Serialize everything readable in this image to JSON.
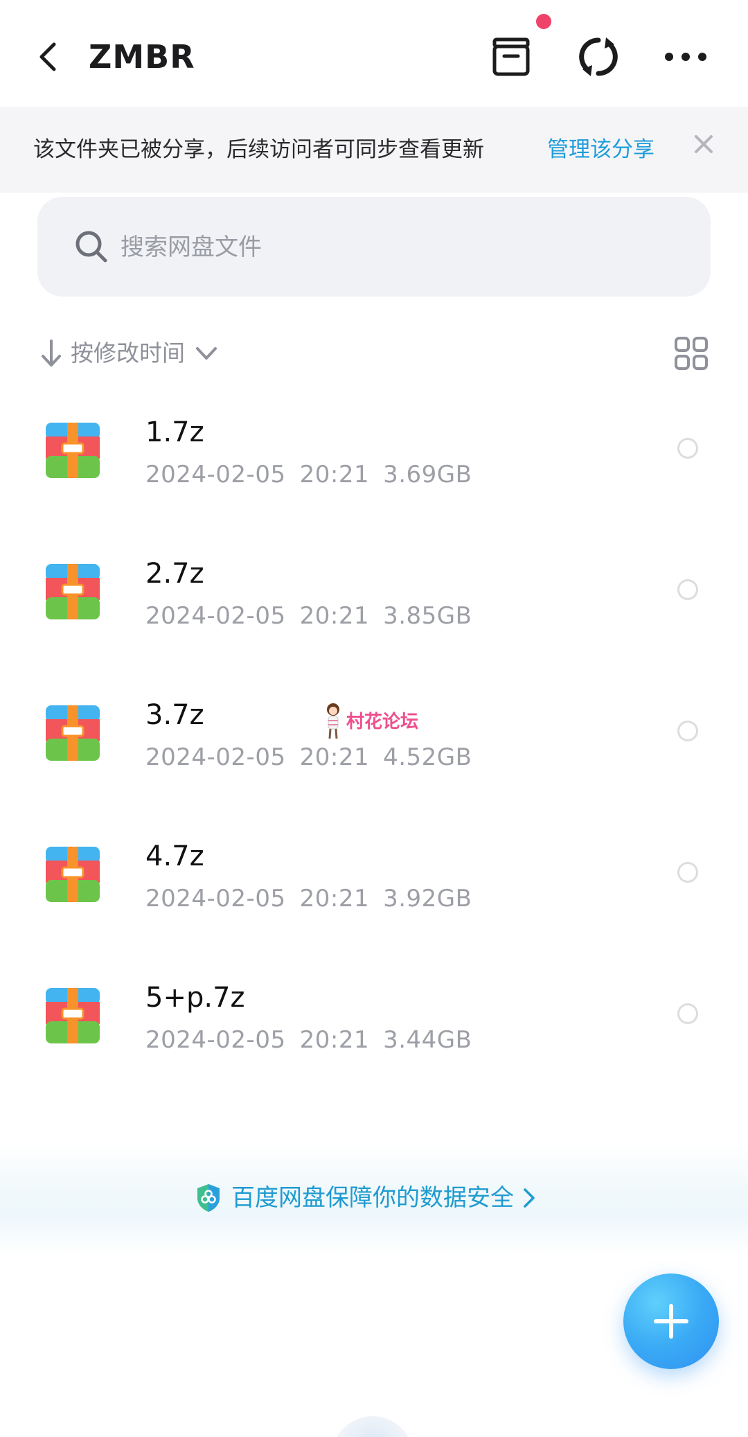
{
  "header": {
    "title": "ZMBR",
    "back_icon": "chevron-left-icon",
    "actions": [
      {
        "name": "archive",
        "icon": "archive-box-icon"
      },
      {
        "name": "sync",
        "icon": "sync-icon"
      },
      {
        "name": "more",
        "icon": "more-horizontal-icon"
      }
    ],
    "notification_color": "#f0436a"
  },
  "share_banner": {
    "text": "该文件夹已被分享，后续访问者可同步查看更新",
    "link_label": "管理该分享",
    "link_color": "#1f9ddb"
  },
  "search": {
    "placeholder": "搜索网盘文件"
  },
  "sort": {
    "label": "按修改时间"
  },
  "files": [
    {
      "name": "1.7z",
      "date": "2024-02-05",
      "time": "20:21",
      "size": "3.69GB"
    },
    {
      "name": "2.7z",
      "date": "2024-02-05",
      "time": "20:21",
      "size": "3.85GB"
    },
    {
      "name": "3.7z",
      "date": "2024-02-05",
      "time": "20:21",
      "size": "4.52GB"
    },
    {
      "name": "4.7z",
      "date": "2024-02-05",
      "time": "20:21",
      "size": "3.92GB"
    },
    {
      "name": "5+p.7z",
      "date": "2024-02-05",
      "time": "20:21",
      "size": "3.44GB"
    }
  ],
  "watermark": {
    "text": "村花论坛"
  },
  "security_banner": {
    "text": "百度网盘保障你的数据安全",
    "color": "#1f9bd0"
  },
  "fab": {
    "icon": "plus-icon",
    "color": "#3aaaf5"
  }
}
